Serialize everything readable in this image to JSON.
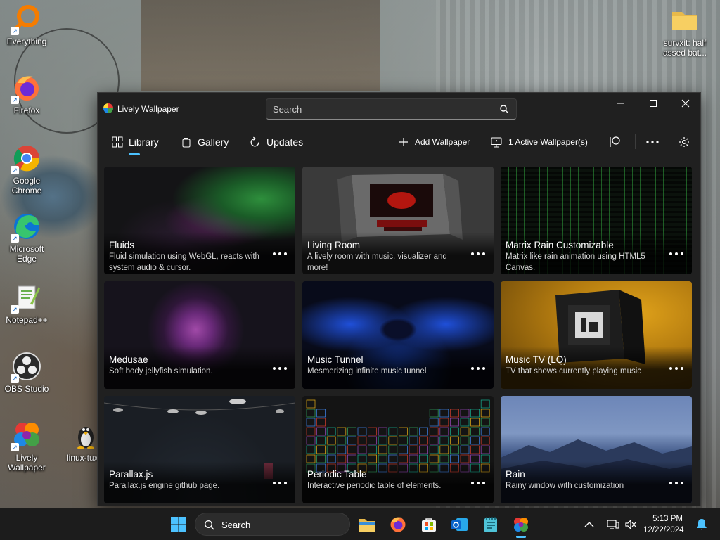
{
  "desktop": {
    "icons": [
      {
        "label": "Everything"
      },
      {
        "label": "Firefox"
      },
      {
        "label": "Google Chrome"
      },
      {
        "label": "Microsoft Edge"
      },
      {
        "label": "Notepad++"
      },
      {
        "label": "OBS Studio"
      },
      {
        "label": "Lively Wallpaper"
      },
      {
        "label": "linux-tux.c"
      },
      {
        "label": "survxit: half assed bat..."
      }
    ]
  },
  "window": {
    "title": "Lively Wallpaper",
    "search_placeholder": "Search",
    "nav": {
      "library": "Library",
      "gallery": "Gallery",
      "updates": "Updates"
    },
    "toolbar": {
      "add_wallpaper": "Add Wallpaper",
      "active_wallpapers": "1 Active Wallpaper(s)"
    },
    "cards": [
      {
        "title": "Fluids",
        "desc": "Fluid simulation using WebGL, reacts with system audio & cursor."
      },
      {
        "title": "Living Room",
        "desc": "A lively room with music, visualizer and more!"
      },
      {
        "title": "Matrix Rain Customizable",
        "desc": "Matrix like rain animation using HTML5 Canvas."
      },
      {
        "title": "Medusae",
        "desc": "Soft body jellyfish simulation."
      },
      {
        "title": "Music Tunnel",
        "desc": "Mesmerizing infinite music tunnel"
      },
      {
        "title": "Music TV (LQ)",
        "desc": "TV that shows currently playing music"
      },
      {
        "title": "Parallax.js",
        "desc": "Parallax.js engine github page."
      },
      {
        "title": "Periodic Table",
        "desc": "Interactive periodic table of elements."
      },
      {
        "title": "Rain",
        "desc": "Rainy window with customization"
      }
    ]
  },
  "taskbar": {
    "search_label": "Search",
    "time": "5:13 PM",
    "date": "12/22/2024"
  },
  "colors": {
    "accent": "#4cc2ff",
    "window_bg": "#202020",
    "taskbar_bg": "#1c1c1c"
  }
}
